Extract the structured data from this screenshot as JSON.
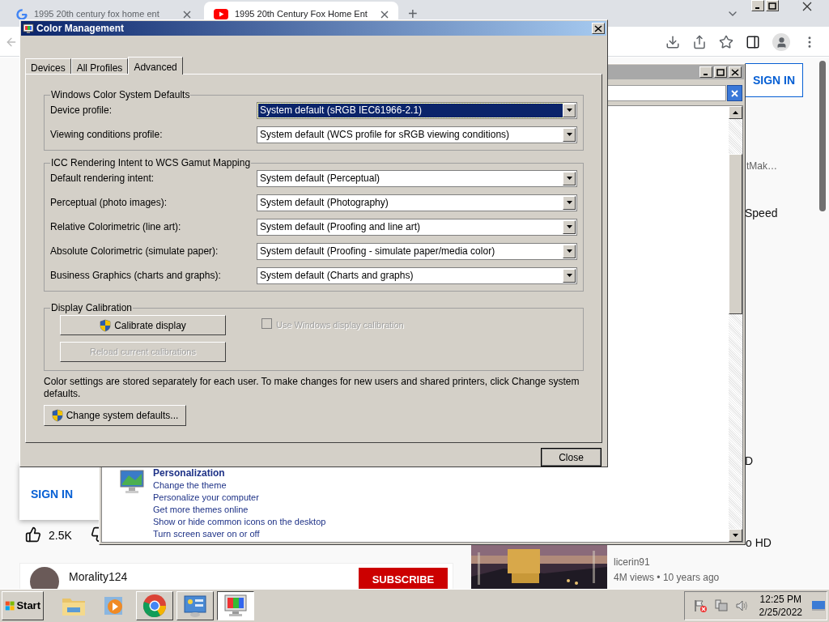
{
  "browser": {
    "tabs": [
      {
        "title": "1995 20th century fox home ent",
        "kind": "google",
        "selected": false
      },
      {
        "title": "1995 20th Century Fox Home Ent",
        "kind": "youtube",
        "selected": true
      }
    ],
    "new_tab": "+"
  },
  "page": {
    "sign_in_top": "SIGN IN",
    "snippets": [
      {
        "text": "tMak…",
        "kind": "muted"
      },
      {
        "text": "Speed",
        "kind": "title"
      },
      {
        "text": "D",
        "kind": "title"
      },
      {
        "text": "o HD",
        "kind": "title"
      }
    ],
    "sign_in_popup": "SIGN IN",
    "likes": "2.5K",
    "channel": "Morality124",
    "subscribe": "SUBSCRIBE",
    "video": {
      "channel": "licerin91",
      "meta": "4M views • 10 years ago"
    }
  },
  "control_panel": {
    "section": {
      "title": "Personalization",
      "links": [
        "Change the theme",
        "Personalize your computer",
        "Get more themes online",
        "Show or hide common icons on the desktop",
        "Turn screen saver on or off"
      ]
    }
  },
  "dialog": {
    "title": "Color Management",
    "tabs": [
      {
        "label": "Devices",
        "selected": false
      },
      {
        "label": "All Profiles",
        "selected": false
      },
      {
        "label": "Advanced",
        "selected": true
      }
    ],
    "groups": [
      {
        "title": "Windows Color System Defaults",
        "rows": [
          {
            "label": "Device profile:",
            "value": "System default (sRGB IEC61966-2.1)",
            "focused": true
          },
          {
            "label": "Viewing conditions profile:",
            "value": "System default (WCS profile for sRGB viewing conditions)",
            "focused": false
          }
        ]
      },
      {
        "title": "ICC Rendering Intent to WCS Gamut Mapping",
        "rows": [
          {
            "label": "Default rendering intent:",
            "value": "System default (Perceptual)",
            "focused": false
          },
          {
            "label": "Perceptual (photo images):",
            "value": "System default (Photography)",
            "focused": false
          },
          {
            "label": "Relative Colorimetric (line art):",
            "value": "System default (Proofing and line art)",
            "focused": false
          },
          {
            "label": "Absolute Colorimetric (simulate paper):",
            "value": "System default (Proofing - simulate paper/media color)",
            "focused": false
          },
          {
            "label": "Business Graphics (charts and graphs):",
            "value": "System default (Charts and graphs)",
            "focused": false
          }
        ]
      }
    ],
    "calibration": {
      "title": "Display Calibration",
      "calibrate": {
        "label": "Calibrate display",
        "disabled": false
      },
      "reload": {
        "label": "Reload current calibrations",
        "disabled": true
      },
      "checkbox": {
        "label": "Use Windows display calibration",
        "checked": false,
        "disabled": true
      }
    },
    "note": "Color settings are stored separately for each user. To make changes for new users and shared printers, click Change system defaults.",
    "change_defaults": "Change system defaults...",
    "close": "Close"
  },
  "taskbar": {
    "start": "Start",
    "apps": [
      {
        "kind": "folder",
        "active": false
      },
      {
        "kind": "media",
        "active": false
      },
      {
        "kind": "chrome",
        "active": false
      },
      {
        "kind": "control-panel",
        "active": false
      },
      {
        "kind": "display",
        "active": true
      }
    ],
    "time": "12:25 PM",
    "date": "2/25/2022"
  }
}
